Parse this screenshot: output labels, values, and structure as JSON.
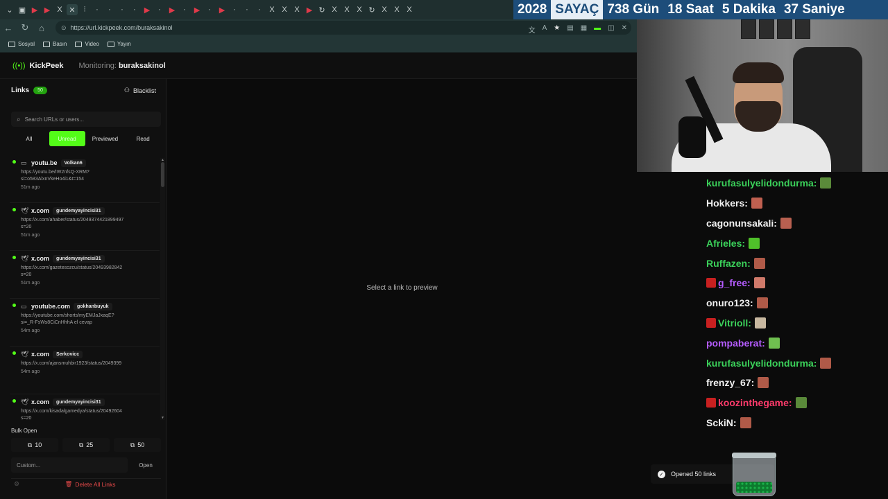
{
  "browser": {
    "url": "https://url.kickpeek.com/buraksakinol",
    "bookmarks": [
      "Sosyal",
      "Basın",
      "Video",
      "Yayın"
    ]
  },
  "counter": {
    "year": "2028",
    "label": "SAYAÇ",
    "days": "738 Gün",
    "hours": "18 Saat",
    "minutes": "5 Dakika",
    "seconds": "37 Saniye"
  },
  "app": {
    "name": "KickPeek",
    "monitoring_label": "Monitoring:",
    "monitoring_user": "buraksakinol",
    "accent": "#53fc18"
  },
  "sidebar": {
    "title": "Links",
    "count": "50",
    "blacklist_label": "Blacklist",
    "search_placeholder": "Search URLs or users...",
    "filters": [
      "All",
      "Unread",
      "Previewed",
      "Read"
    ],
    "active_filter": "Unread",
    "links": [
      {
        "icon": "video-icon",
        "domain": "youtu.be",
        "user": "Volkan6",
        "url": "https://youtu.be/IW2nfsQ-XRM?\nsi=o583AlxnVkeHo4i1&t=154",
        "time": "51m ago"
      },
      {
        "icon": "bird-icon",
        "domain": "x.com",
        "user": "gundemyayincisi31",
        "url": "https://x.com/ahaber/status/2049374421899497\ns=20",
        "time": "51m ago"
      },
      {
        "icon": "bird-icon",
        "domain": "x.com",
        "user": "gundemyayincisi31",
        "url": "https://x.com/gazetesozcu/status/20493982842\ns=20",
        "time": "51m ago"
      },
      {
        "icon": "video-icon",
        "domain": "youtube.com",
        "user": "gokhanbuyuk",
        "url": "https://youtube.com/shorts/myEMJaJxaqE?\nsi=_R-FsWs8CiCnHhhA el cevap",
        "time": "54m ago"
      },
      {
        "icon": "bird-icon",
        "domain": "x.com",
        "user": "Serkovicc",
        "url": "https://x.com/ajansmuhbir1923/status/2049399",
        "time": "54m ago"
      },
      {
        "icon": "bird-icon",
        "domain": "x.com",
        "user": "gundemyayincisi31",
        "url": "https://x.com/kisadalgamedya/status/20492604\ns=20",
        "time": "57m ago"
      }
    ],
    "bulk_title": "Bulk Open",
    "bulk_options": [
      "10",
      "25",
      "50"
    ],
    "custom_placeholder": "Custom...",
    "open_label": "Open",
    "delete_label": "Delete All Links"
  },
  "preview": {
    "empty_text": "Select a link to preview"
  },
  "chat": [
    {
      "user": "kurufasulyelidondurma:",
      "color": "#3bd15a",
      "emote": "#5a8a3a",
      "badge": false
    },
    {
      "user": "Hokkers:",
      "color": "#f0f0f0",
      "emote": "#c06050",
      "badge": false
    },
    {
      "user": "cagonunsakali:",
      "color": "#f0f0f0",
      "emote": "#b86050",
      "badge": false
    },
    {
      "user": "Afrieles:",
      "color": "#3bd15a",
      "emote": "#4fc02a",
      "badge": false
    },
    {
      "user": "Ruffazen:",
      "color": "#3bd15a",
      "emote": "#b05a48",
      "badge": false
    },
    {
      "user": "g_free:",
      "color": "#b55cff",
      "emote": "#d07a6a",
      "badge": true
    },
    {
      "user": "onuro123:",
      "color": "#f0f0f0",
      "emote": "#b05a48",
      "badge": false
    },
    {
      "user": "Vitrioll:",
      "color": "#3bd15a",
      "emote": "#c8b8a0",
      "badge": true
    },
    {
      "user": "pompaberat:",
      "color": "#b55cff",
      "emote": "#6fbf50",
      "badge": false
    },
    {
      "user": "kurufasulyelidondurma:",
      "color": "#3bd15a",
      "emote": "#b05a48",
      "badge": false
    },
    {
      "user": "frenzy_67:",
      "color": "#f0f0f0",
      "emote": "#b05a48",
      "badge": false
    },
    {
      "user": "koozinthegame:",
      "color": "#ff3b6b",
      "emote": "#5a8a3a",
      "badge": true
    },
    {
      "user": "SckiN:",
      "color": "#f0f0f0",
      "emote": "#b05a48",
      "badge": false
    }
  ],
  "toast": {
    "message": "Opened 50 links"
  }
}
